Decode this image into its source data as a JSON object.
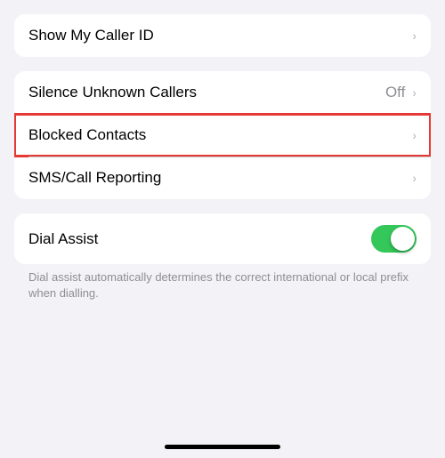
{
  "groups": [
    {
      "id": "caller-id-group",
      "rows": [
        {
          "id": "show-caller-id",
          "label": "Show My Caller ID",
          "value": "",
          "highlighted": false,
          "hasChevron": true
        }
      ]
    },
    {
      "id": "callers-group",
      "rows": [
        {
          "id": "silence-unknown",
          "label": "Silence Unknown Callers",
          "value": "Off",
          "highlighted": false,
          "hasChevron": true
        },
        {
          "id": "blocked-contacts",
          "label": "Blocked Contacts",
          "value": "",
          "highlighted": true,
          "hasChevron": true
        },
        {
          "id": "sms-call-reporting",
          "label": "SMS/Call Reporting",
          "value": "",
          "highlighted": false,
          "hasChevron": true
        }
      ]
    },
    {
      "id": "dial-assist-group",
      "rows": [
        {
          "id": "dial-assist",
          "label": "Dial Assist",
          "value": "",
          "highlighted": false,
          "hasChevron": false,
          "hasToggle": true,
          "toggleOn": true
        }
      ],
      "description": "Dial assist automatically determines the correct international or local prefix when dialling."
    }
  ],
  "homeBar": true
}
